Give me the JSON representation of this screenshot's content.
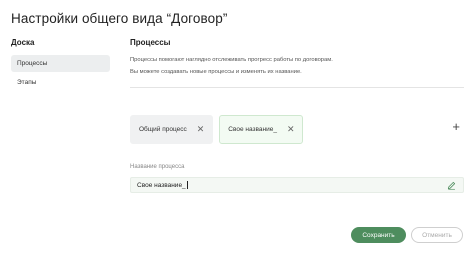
{
  "page": {
    "title": "Настройки общего вида “Договор”"
  },
  "sidebar": {
    "heading": "Доска",
    "items": [
      {
        "label": "Процессы",
        "active": true
      },
      {
        "label": "Этапы",
        "active": false
      }
    ]
  },
  "main": {
    "heading": "Процессы",
    "description": [
      "Процессы помогают наглядно отслеживать прогресс работы по договорам.",
      "Вы можете создавать новые процессы и изменять их название."
    ],
    "chips": [
      {
        "label": "Общий процесс",
        "active": false
      },
      {
        "label": "Свое название_",
        "active": true
      }
    ],
    "field": {
      "label": "Название процесса",
      "value": "Свое название_"
    }
  },
  "actions": {
    "save_label": "Сохранить",
    "cancel_label": "Отменить"
  },
  "colors": {
    "primary": "#4e8d5e",
    "active_chip_bg": "#f3fbf3",
    "field_bg": "#f4f8f4"
  },
  "icons": {
    "chip_close": "close-icon",
    "add": "plus-icon",
    "edit": "pencil-icon"
  }
}
